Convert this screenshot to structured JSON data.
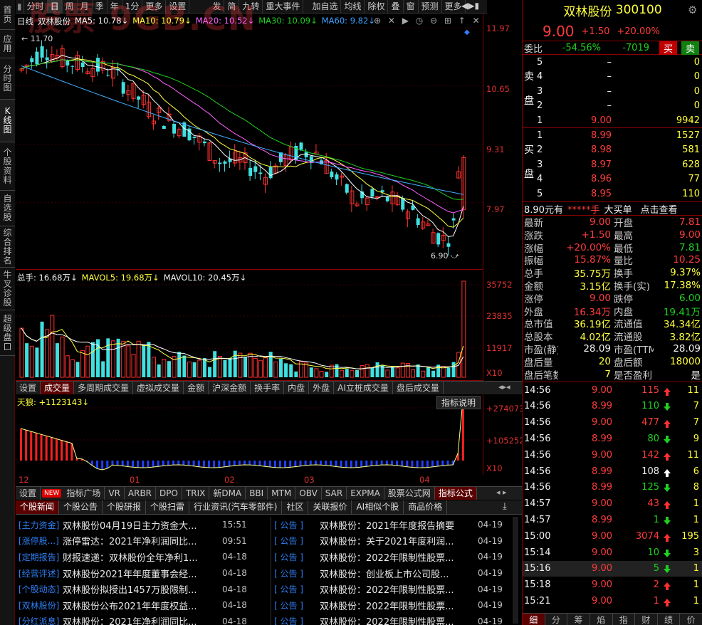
{
  "left_tabs": [
    "首页",
    "应用",
    "分时图",
    "K线图",
    "个股资料",
    "自选股",
    "综合排名",
    "牛叉诊股",
    "超级盘口"
  ],
  "toolbar": [
    "分时",
    "日",
    "周",
    "月",
    "季",
    "年",
    "1分",
    "更多",
    "设置",
    "发",
    "简",
    "九转",
    "重大事件",
    "加自选",
    "均线",
    "除权",
    "叠",
    "窗",
    "预测",
    "更多"
  ],
  "watermark": "股票 9GB.CN",
  "legend": {
    "period": "日线",
    "stock": "双林股份",
    "ma5": "MA5: 10.78↓",
    "ma10": "MA10: 10.79↓",
    "ma20": "MA20: 10.52↓",
    "ma30": "MA30: 10.09↓",
    "ma60": "MA60: 9.82↓"
  },
  "price_axis": [
    "11.97",
    "10.65",
    "9.31",
    "7.97"
  ],
  "price_notes": {
    "high": "11.70",
    "low": "6.90"
  },
  "vol_legend": {
    "total": "总手: 16.68万↓",
    "mavol5": "MAVOL5: 19.68万↓",
    "mavol10": "MAVOL10: 20.45万↓"
  },
  "vol_axis": [
    "35752",
    "23835",
    "11917",
    "X10"
  ],
  "sub_tabs": [
    "设置",
    "成交量",
    "多周期成交量",
    "虚拟成交量",
    "金额",
    "沪深金额",
    "换手率",
    "内盘",
    "外盘",
    "AI立桩成交量",
    "盘后成交量"
  ],
  "ind_legend": "天狼: +1123143↓",
  "ind_button": "指标说明",
  "ind_axis": [
    "+274073",
    "+105252",
    "X10"
  ],
  "x_labels": [
    "12",
    "01",
    "02",
    "03",
    "04"
  ],
  "bottom_tabs": [
    "设置",
    "NEW",
    "指标广场",
    "VR",
    "ARBR",
    "DPO",
    "TRIX",
    "新DMA",
    "BBI",
    "MTM",
    "OBV",
    "SAR",
    "EXPMA",
    "股票公式网",
    "指标公式"
  ],
  "news_tabs": [
    "个股新闻",
    "个股公告",
    "个股研报",
    "个股扫雷",
    "行业资讯(汽车零部件)",
    "社区",
    "关联报价",
    "AI相似个股",
    "商品价格"
  ],
  "news_left": [
    {
      "cat": "[主力资金]",
      "title": "双林股份04月19日主力资金大...",
      "time": "15:51"
    },
    {
      "cat": "[涨停股...]",
      "title": "涨停雷达：2021年净利润同比...",
      "time": "09:51"
    },
    {
      "cat": "[定期报告]",
      "title": "财报速递：双林股份全年净利1...",
      "time": "04-18"
    },
    {
      "cat": "[经营评述]",
      "title": "双林股份2021年年度董事会经...",
      "time": "04-18"
    },
    {
      "cat": "[个股动态]",
      "title": "双林股份拟授出1457万股限制...",
      "time": "04-18"
    },
    {
      "cat": "[双林股份]",
      "title": "双林股份公布2021年年度权益...",
      "time": "04-18"
    },
    {
      "cat": "[分红派息]",
      "title": "双林股份：2021年净利润同比...",
      "time": "04-18"
    }
  ],
  "news_right": [
    {
      "cat": "[  公告  ]",
      "title": "双林股份：2021年年度报告摘要",
      "time": "04-19"
    },
    {
      "cat": "[  公告  ]",
      "title": "双林股份：关于2021年度利润...",
      "time": "04-19"
    },
    {
      "cat": "[  公告  ]",
      "title": "双林股份：2022年限制性股票...",
      "time": "04-19"
    },
    {
      "cat": "[  公告  ]",
      "title": "双林股份：创业板上市公司股...",
      "time": "04-19"
    },
    {
      "cat": "[  公告  ]",
      "title": "双林股份：2022年限制性股票...",
      "time": "04-19"
    },
    {
      "cat": "[  公告  ]",
      "title": "双林股份：2022年限制性股票...",
      "time": "04-19"
    },
    {
      "cat": "[  公告  ]",
      "title": "双林股份：2022年限制性股票...",
      "time": "04-19"
    }
  ],
  "quote": {
    "name": "双林股份",
    "code": "300100",
    "price": "9.00",
    "change": "+1.50",
    "pct": "+20.00%",
    "weibi_label": "委比",
    "weibi": "-54.56%",
    "weicha": "-7019",
    "buy": "买",
    "sell": "卖"
  },
  "sell_label": "卖盘",
  "buy_label": "买盘",
  "asks": [
    {
      "lv": "5",
      "p": "–",
      "v": "0"
    },
    {
      "lv": "4",
      "p": "–",
      "v": "0"
    },
    {
      "lv": "3",
      "p": "–",
      "v": "0"
    },
    {
      "lv": "2",
      "p": "–",
      "v": "0"
    },
    {
      "lv": "1",
      "p": "9.00",
      "v": "9942"
    }
  ],
  "bids": [
    {
      "lv": "1",
      "p": "8.99",
      "v": "1527"
    },
    {
      "lv": "2",
      "p": "8.98",
      "v": "581"
    },
    {
      "lv": "3",
      "p": "8.97",
      "v": "628"
    },
    {
      "lv": "4",
      "p": "8.96",
      "v": "77"
    },
    {
      "lv": "5",
      "p": "8.95",
      "v": "110"
    }
  ],
  "bigorder": {
    "price": "8.90元有",
    "qty": "*****手",
    "label": "大买单",
    "link": "点击查看"
  },
  "stats": [
    [
      "最新",
      "9.00",
      "开盘",
      "7.81"
    ],
    [
      "涨跌",
      "+1.50",
      "最高",
      "9.00"
    ],
    [
      "涨幅",
      "+20.00%",
      "最低",
      "7.81"
    ],
    [
      "振幅",
      "15.87%",
      "量比",
      "10.25"
    ],
    [
      "总手",
      "35.75万",
      "换手",
      "9.37%"
    ],
    [
      "金额",
      "3.15亿",
      "换手(实)",
      "17.38%"
    ],
    [
      "涨停",
      "9.00",
      "跌停",
      "6.00"
    ],
    [
      "外盘",
      "16.34万",
      "内盘",
      "19.41万"
    ],
    [
      "总市值",
      "36.19亿",
      "流通值",
      "34.34亿"
    ],
    [
      "总股本",
      "4.02亿",
      "流通股",
      "3.82亿"
    ],
    [
      "市盈(静)",
      "28.09",
      "市盈(TTM)",
      "28.09"
    ],
    [
      "盘后量",
      "20",
      "盘后额",
      "18000"
    ],
    [
      "盘后笔数",
      "7",
      "是否盈利",
      "是"
    ]
  ],
  "ticks": [
    {
      "t": "14:56",
      "p": "9.00",
      "v": "115",
      "d": "up",
      "n": "11"
    },
    {
      "t": "14:56",
      "p": "8.99",
      "v": "110",
      "d": "dn",
      "n": "7"
    },
    {
      "t": "14:56",
      "p": "9.00",
      "v": "477",
      "d": "up",
      "n": "7"
    },
    {
      "t": "14:56",
      "p": "8.99",
      "v": "80",
      "d": "dn",
      "n": "9"
    },
    {
      "t": "14:56",
      "p": "9.00",
      "v": "142",
      "d": "up",
      "n": "11"
    },
    {
      "t": "14:56",
      "p": "8.99",
      "v": "108",
      "d": "w",
      "n": "6"
    },
    {
      "t": "14:56",
      "p": "8.99",
      "v": "125",
      "d": "dn",
      "n": "8"
    },
    {
      "t": "14:57",
      "p": "9.00",
      "v": "43",
      "d": "up",
      "n": "1"
    },
    {
      "t": "14:57",
      "p": "8.99",
      "v": "1",
      "d": "dn",
      "n": "1"
    },
    {
      "t": "15:00",
      "p": "9.00",
      "v": "3074",
      "d": "up",
      "n": "195"
    },
    {
      "t": "15:14",
      "p": "9.00",
      "v": "10",
      "d": "dn",
      "n": "3"
    },
    {
      "t": "15:16",
      "p": "9.00",
      "v": "5",
      "d": "dn",
      "n": "1"
    },
    {
      "t": "15:18",
      "p": "9.00",
      "v": "2",
      "d": "up",
      "n": "1"
    },
    {
      "t": "15:21",
      "p": "9.00",
      "v": "1",
      "d": "up",
      "n": "1"
    }
  ],
  "bottom_right_tabs": [
    "细",
    "分",
    "筹",
    "焰",
    "指",
    "财",
    "绩",
    "价"
  ]
}
